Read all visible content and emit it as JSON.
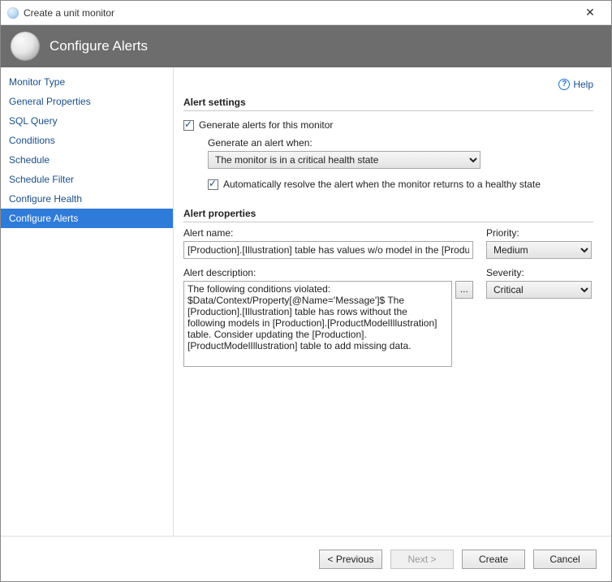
{
  "window": {
    "title": "Create a unit monitor",
    "close_icon": "✕"
  },
  "banner": {
    "title": "Configure Alerts"
  },
  "sidebar": {
    "items": [
      {
        "label": "Monitor Type",
        "active": false
      },
      {
        "label": "General Properties",
        "active": false
      },
      {
        "label": "SQL Query",
        "active": false
      },
      {
        "label": "Conditions",
        "active": false
      },
      {
        "label": "Schedule",
        "active": false
      },
      {
        "label": "Schedule Filter",
        "active": false
      },
      {
        "label": "Configure Health",
        "active": false
      },
      {
        "label": "Configure Alerts",
        "active": true
      }
    ]
  },
  "help": {
    "label": "Help"
  },
  "settings": {
    "heading": "Alert settings",
    "generate_label": "Generate alerts for this monitor",
    "generate_checked": true,
    "when_label": "Generate an alert when:",
    "when_value": "The monitor is in a critical health state",
    "auto_resolve_label": "Automatically resolve the alert when the monitor returns to a healthy state",
    "auto_resolve_checked": true
  },
  "properties": {
    "heading": "Alert properties",
    "name_label": "Alert name:",
    "name_value": "[Production].[Illustration] table has values w/o model in the [Production].[ProductModelIllustration] table",
    "priority_label": "Priority:",
    "priority_value": "Medium",
    "description_label": "Alert description:",
    "description_value": "The following conditions violated:\n$Data/Context/Property[@Name='Message']$ The [Production].[Illustration] table has rows without the following models in [Production].[ProductModelIllustration] table. Consider updating the [Production].[ProductModelIllustration] table to add missing data.",
    "ellipsis": "...",
    "severity_label": "Severity:",
    "severity_value": "Critical"
  },
  "footer": {
    "previous": "< Previous",
    "next": "Next >",
    "create": "Create",
    "cancel": "Cancel"
  }
}
